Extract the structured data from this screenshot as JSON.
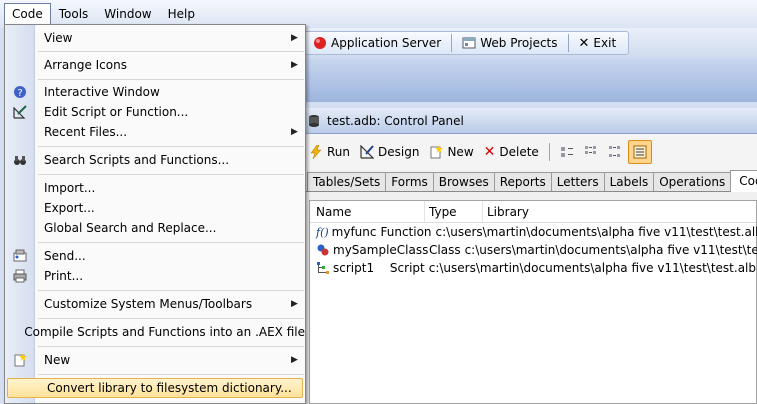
{
  "menubar": {
    "items": [
      {
        "label": "Code",
        "active": true
      },
      {
        "label": "Tools",
        "active": false
      },
      {
        "label": "Window",
        "active": false
      },
      {
        "label": "Help",
        "active": false
      }
    ]
  },
  "toolbar": {
    "application_server": "Application Server",
    "web_projects": "Web Projects",
    "exit": "Exit"
  },
  "code_menu": {
    "items": [
      {
        "label": "View",
        "submenu": true
      },
      {
        "label": "Arrange Icons",
        "submenu": true
      },
      {
        "label": "Interactive Window",
        "icon": "help-circle-icon"
      },
      {
        "label": "Edit Script or Function...",
        "icon": "edit-script-icon"
      },
      {
        "label": "Recent Files...",
        "submenu": true
      },
      {
        "label": "Search Scripts and Functions...",
        "icon": "binoculars-icon"
      },
      {
        "label": "Import..."
      },
      {
        "label": "Export..."
      },
      {
        "label": "Global Search and Replace..."
      },
      {
        "label": "Send...",
        "icon": "send-icon"
      },
      {
        "label": "Print...",
        "icon": "print-icon"
      },
      {
        "label": "Customize System Menus/Toolbars",
        "submenu": true
      },
      {
        "label": "Compile Scripts and Functions into an .AEX file"
      },
      {
        "label": "New",
        "submenu": true,
        "icon": "new-document-icon"
      },
      {
        "label": "Convert library to filesystem dictionary...",
        "highlighted": true
      }
    ]
  },
  "control_panel": {
    "title": "test.adb: Control Panel",
    "toolbar": {
      "run": "Run",
      "design": "Design",
      "new": "New",
      "delete": "Delete"
    },
    "tabs": [
      "Tables/Sets",
      "Forms",
      "Browses",
      "Reports",
      "Letters",
      "Labels",
      "Operations",
      "Code"
    ],
    "selected_tab": "Code",
    "columns": [
      "Name",
      "Type",
      "Library"
    ],
    "rows": [
      {
        "name": "myfunc",
        "type": "Function",
        "library": "c:\\users\\martin\\documents\\alpha five v11\\test\\test.alb",
        "icon": "function-icon"
      },
      {
        "name": "mySampleClass",
        "type": "Class",
        "library": "c:\\users\\martin\\documents\\alpha five v11\\test\\test.alb",
        "icon": "class-icon"
      },
      {
        "name": "script1",
        "type": "Script",
        "library": "c:\\users\\martin\\documents\\alpha five v11\\test\\test.alb",
        "icon": "script-icon"
      }
    ]
  },
  "colors": {
    "menu_highlight": "#ffe29a",
    "active_view_button": "#ffd48c",
    "title_band": "#b9cbe8"
  }
}
